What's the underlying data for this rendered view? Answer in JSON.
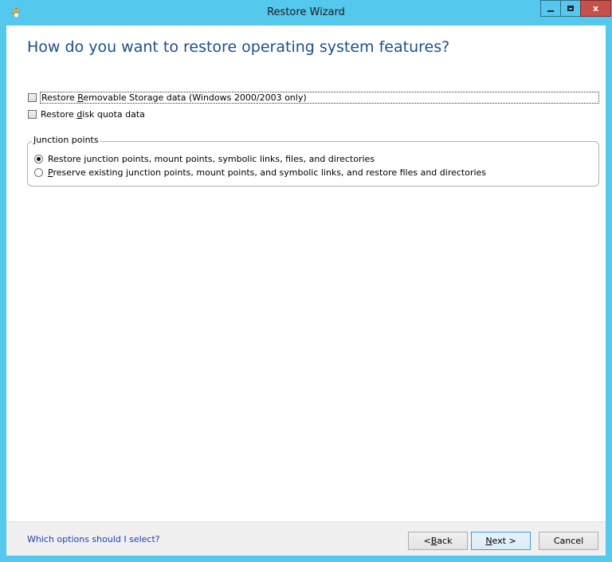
{
  "window": {
    "title": "Restore Wizard",
    "close_glyph": "x",
    "accent_color": "#55c8ee"
  },
  "page": {
    "heading": "How do you want to restore operating system features?"
  },
  "options": {
    "removable_storage": {
      "pre": "Restore ",
      "access_key": "R",
      "post": "emovable Storage data (Windows 2000/2003 only)",
      "checked": false
    },
    "disk_quota": {
      "pre": "Restore ",
      "access_key": "d",
      "post": "isk quota data",
      "checked": false
    }
  },
  "junction_points": {
    "legend": "Junction points",
    "restore": {
      "pre": "Restore ",
      "access_key": "j",
      "post": "unction points, mount points, symbolic links, files, and directories",
      "selected": true
    },
    "preserve": {
      "pre": "",
      "access_key": "P",
      "post": "reserve existing junction points, mount points, and symbolic links, and restore files and directories",
      "selected": false
    }
  },
  "footer": {
    "help_link": "Which options should I select?",
    "back": {
      "pre": "< ",
      "access_key": "B",
      "post": "ack"
    },
    "next": {
      "pre": "",
      "access_key": "N",
      "post": "ext >"
    },
    "cancel": "Cancel"
  }
}
